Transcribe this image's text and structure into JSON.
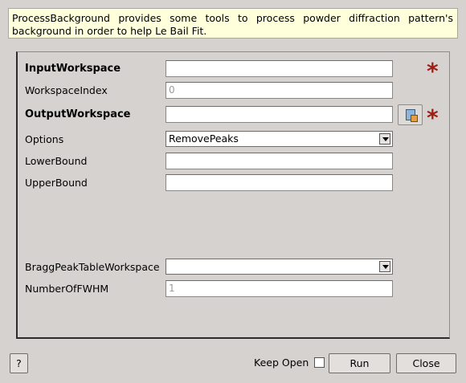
{
  "description": "ProcessBackground provides some tools to process powder diffraction pattern's background in order to help Le Bail Fit.",
  "fields": {
    "input_workspace": {
      "label": "InputWorkspace",
      "value": "",
      "required": true
    },
    "workspace_index": {
      "label": "WorkspaceIndex",
      "value": "",
      "placeholder": "0"
    },
    "output_workspace": {
      "label": "OutputWorkspace",
      "value": "",
      "required": true
    },
    "options": {
      "label": "Options",
      "selected": "RemovePeaks"
    },
    "lower_bound": {
      "label": "LowerBound",
      "value": ""
    },
    "upper_bound": {
      "label": "UpperBound",
      "value": ""
    },
    "bragg_peak_table": {
      "label": "BraggPeakTableWorkspace",
      "selected": ""
    },
    "number_of_fwhm": {
      "label": "NumberOfFWHM",
      "value": "",
      "placeholder": "1"
    }
  },
  "icons": {
    "required": "asterisk-icon",
    "browse": "workspace-browse-icon",
    "dropdown": "chevron-down-icon"
  },
  "colors": {
    "required_star": "#9e1e14",
    "description_bg": "#ffffdc",
    "window_bg": "#d6d2d0"
  },
  "footer": {
    "help_label": "?",
    "keep_open_label": "Keep Open",
    "keep_open_checked": false,
    "run_label": "Run",
    "close_label": "Close"
  }
}
